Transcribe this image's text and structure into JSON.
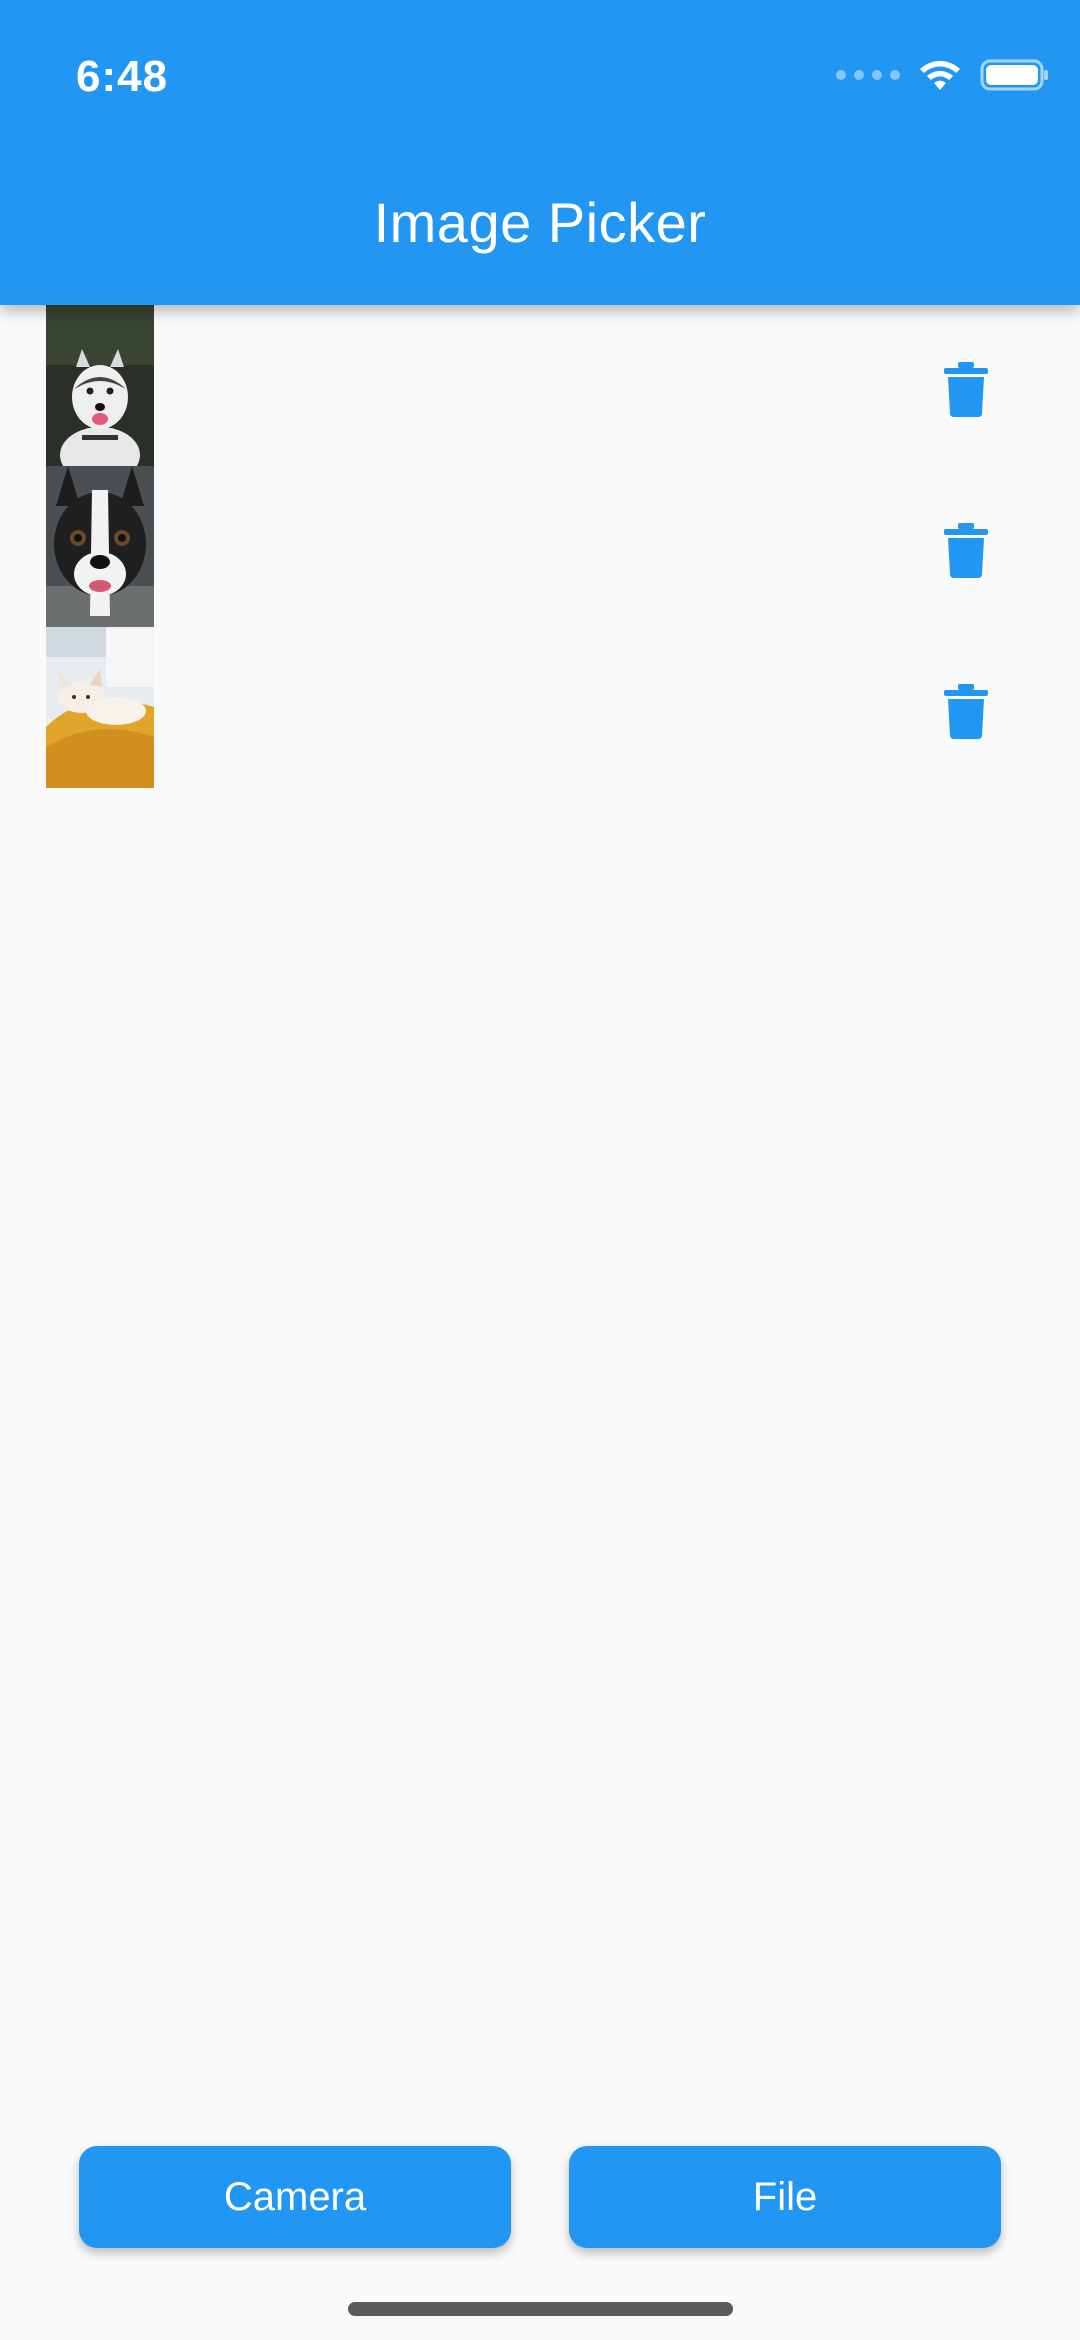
{
  "status_bar": {
    "time": "6:48",
    "signal_icon": "signal-dots-icon",
    "wifi_icon": "wifi-icon",
    "battery_icon": "battery-icon"
  },
  "app_bar": {
    "title": "Image Picker",
    "color": "#2196f3"
  },
  "images": [
    {
      "subject": "husky",
      "delete_icon": "trash-icon"
    },
    {
      "subject": "boston-terrier",
      "delete_icon": "trash-icon"
    },
    {
      "subject": "chihuahua",
      "delete_icon": "trash-icon"
    }
  ],
  "actions": {
    "camera_label": "Camera",
    "file_label": "File"
  }
}
